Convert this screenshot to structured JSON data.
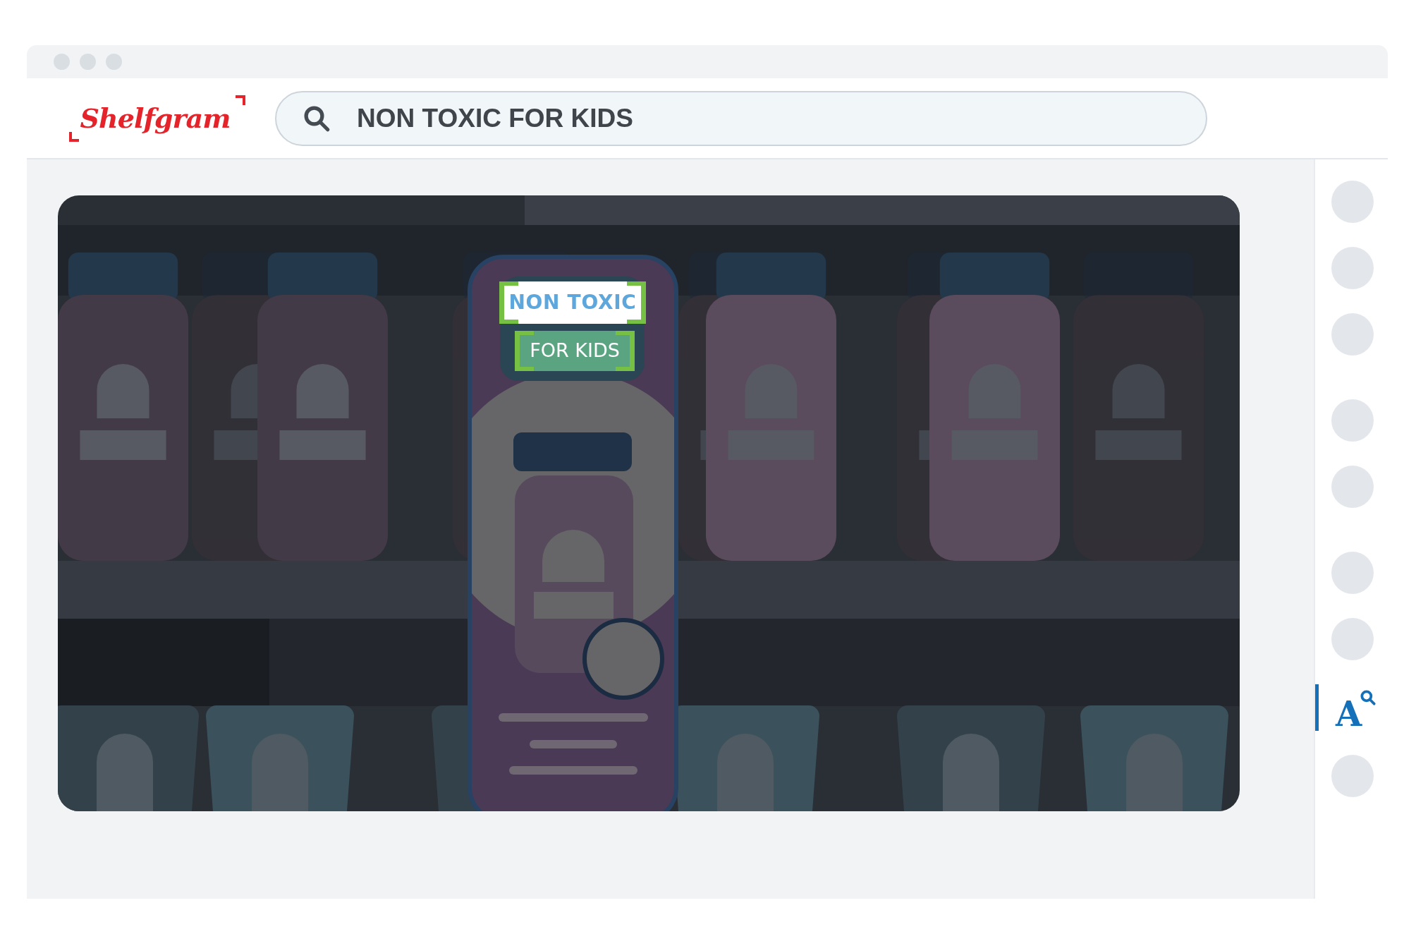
{
  "window": {
    "controls": [
      {
        "kind": "dot"
      },
      {
        "kind": "dot"
      },
      {
        "kind": "dot"
      }
    ]
  },
  "header": {
    "logo": "Shelfgram",
    "search": {
      "value": "NON TOXIC FOR KIDS"
    }
  },
  "product": {
    "labels": [
      {
        "text": "NON TOXIC",
        "kind": "light"
      },
      {
        "text": "FOR KIDS",
        "kind": "dark"
      }
    ]
  },
  "sidebar": {
    "groups": [
      [
        {
          "kind": "placeholder",
          "selected": false
        },
        {
          "kind": "placeholder",
          "selected": false
        },
        {
          "kind": "placeholder",
          "selected": false
        }
      ],
      [
        {
          "kind": "placeholder",
          "selected": false
        },
        {
          "kind": "placeholder",
          "selected": false
        }
      ],
      [
        {
          "kind": "placeholder",
          "selected": false
        },
        {
          "kind": "placeholder",
          "selected": false
        },
        {
          "kind": "text-search",
          "glyph": "A",
          "selected": true
        },
        {
          "kind": "placeholder",
          "selected": false
        }
      ]
    ]
  }
}
